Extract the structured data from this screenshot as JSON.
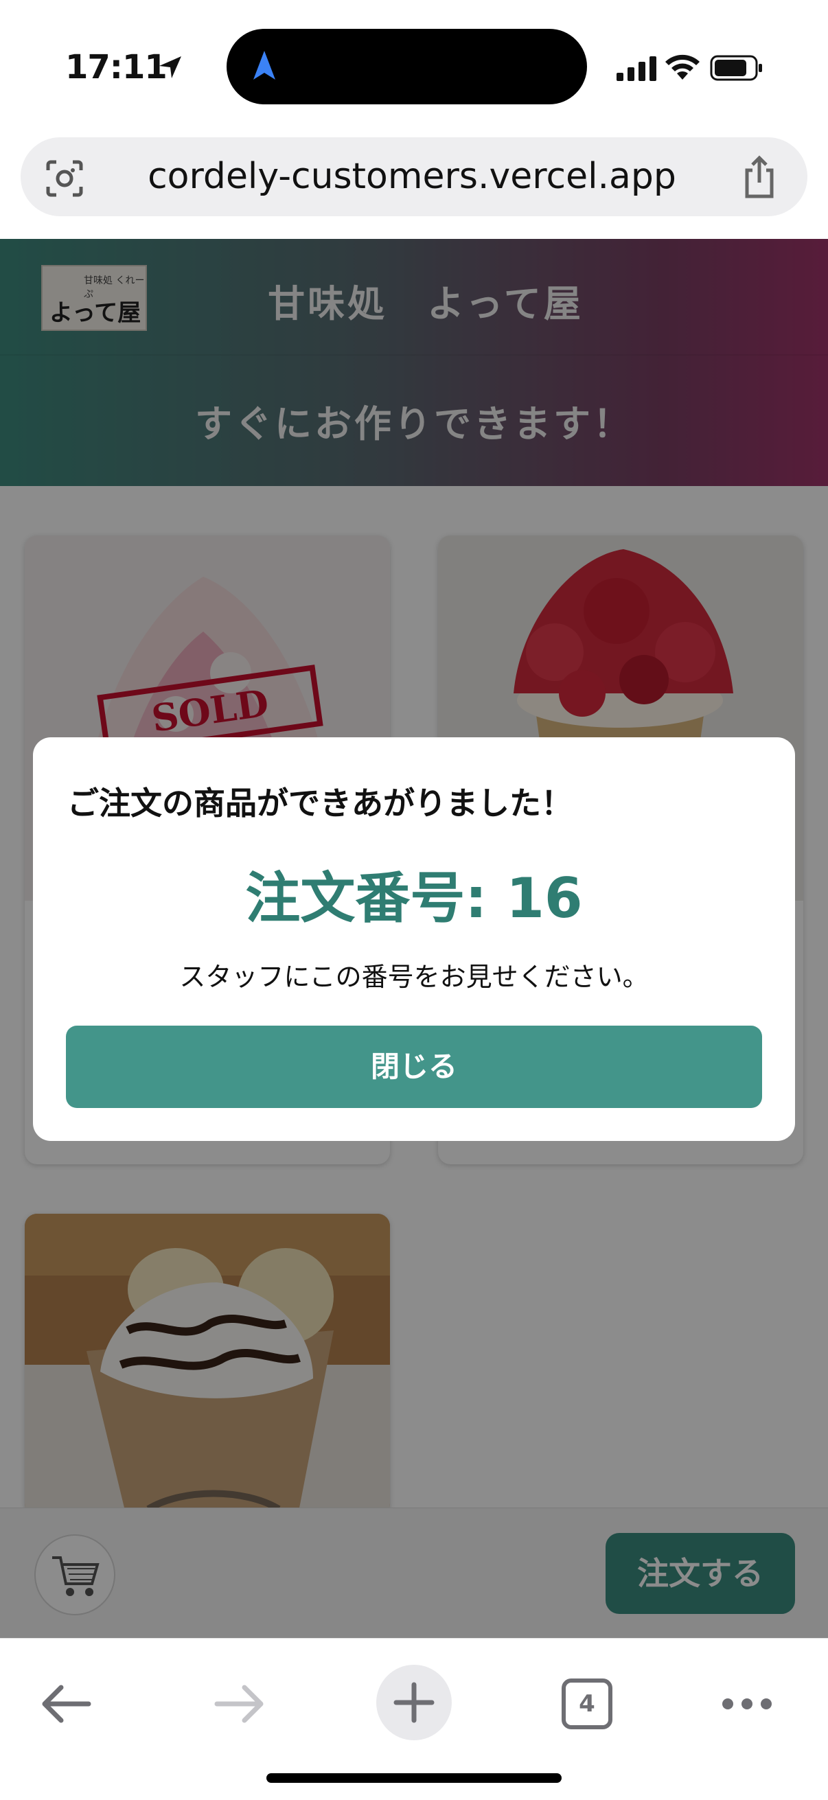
{
  "status_bar": {
    "time": "17:11"
  },
  "browser": {
    "url": "cordely-customers.vercel.app",
    "tab_count": "4"
  },
  "header": {
    "shop_name": "甘味処　よって屋",
    "logo_text": "よって屋",
    "logo_small_text": "甘味処 くれーぷ",
    "ready_message": "すぐにお作りできます！"
  },
  "products": [
    {
      "badge": "SOLD OUT",
      "colors": {
        "bg": "#f0e9ea",
        "accent": "#e58aa0"
      }
    },
    {
      "colors": {
        "bg": "#ece8e4",
        "accent": "#d8283c"
      }
    },
    {
      "colors": {
        "bg": "#b78a57",
        "accent": "#fff8ee"
      }
    }
  ],
  "bottom_bar": {
    "order_label": "注文する"
  },
  "modal": {
    "title": "ご注文の商品ができあがりました！",
    "order_number": "注文番号: 16",
    "note": "スタッフにこの番号をお見せください。",
    "close_label": "閉じる"
  },
  "icons": [
    "location-arrow-icon",
    "signal-icon",
    "wifi-icon",
    "battery-icon",
    "scan-icon",
    "share-icon",
    "cart-icon",
    "back-icon",
    "forward-icon",
    "plus-icon",
    "more-icon"
  ],
  "colors": {
    "accent": "#3b8d80",
    "order_number": "#2f7d72",
    "soldout": "#c8102e"
  }
}
